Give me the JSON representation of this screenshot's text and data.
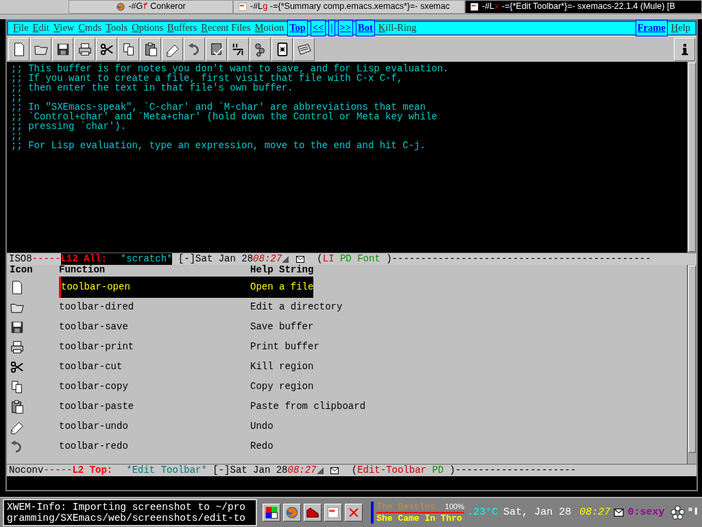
{
  "window_tabs": [
    {
      "kind": "browser",
      "tag": "-#G",
      "mark": "f",
      "title": "Conkeror",
      "selected": false
    },
    {
      "kind": "emacs",
      "tag": "-#L",
      "mark": "g",
      "title": "-={*Summary comp.emacs.xemacs*}=- sxemac",
      "selected": false
    },
    {
      "kind": "emacs",
      "tag": "-#L",
      "mark": "x",
      "title": "-={*Edit Toolbar*}=- sxemacs-22.1.4 (Mule) [B",
      "selected": true
    }
  ],
  "menubar": {
    "items": [
      {
        "label": "File",
        "kind": "plain"
      },
      {
        "label": "Edit",
        "kind": "plain"
      },
      {
        "label": "View",
        "kind": "plain"
      },
      {
        "label": "Cmds",
        "kind": "plain"
      },
      {
        "label": "Tools",
        "kind": "plain"
      },
      {
        "label": "Options",
        "kind": "plain"
      },
      {
        "label": "Buffers",
        "kind": "plain"
      },
      {
        "label": "Recent Files",
        "kind": "plain"
      },
      {
        "label": "Motion",
        "kind": "plain"
      },
      {
        "label": "Top",
        "kind": "boxed"
      },
      {
        "label": "<<",
        "kind": "boxed"
      },
      {
        "label": "|",
        "kind": "boxed"
      },
      {
        "label": ">>",
        "kind": "boxed"
      },
      {
        "label": "Bot",
        "kind": "boxed"
      },
      {
        "label": "Kill-Ring",
        "kind": "plain"
      }
    ],
    "right_items": [
      {
        "label": "Frame",
        "kind": "boxed"
      },
      {
        "label": "Help",
        "kind": "plain"
      }
    ]
  },
  "toolbar": [
    {
      "kind": "new"
    },
    {
      "kind": "open"
    },
    {
      "kind": "save"
    },
    {
      "kind": "print"
    },
    {
      "kind": "cut"
    },
    {
      "kind": "copy"
    },
    {
      "kind": "paste"
    },
    {
      "kind": "undo"
    },
    {
      "kind": "redo"
    },
    {
      "kind": "replace"
    },
    {
      "kind": "spell"
    },
    {
      "kind": "compile"
    },
    {
      "kind": "debug"
    },
    {
      "kind": "news"
    }
  ],
  "editor_lines": [
    ";; This buffer is for notes you don't want to save, and for Lisp evaluation.",
    ";; If you want to create a file, first visit that file with C-x C-f,",
    ";; then enter the text in that file's own buffer.",
    ";;",
    ";; In \"SXEmacs-speak\", `C-char' and `M-char' are abbreviations that mean",
    ";; `Control+char' and `Meta+char' (hold down the Control or Meta key while",
    ";; pressing `char').",
    ";;",
    ";; For Lisp evaluation, type an expression, move to the end and hit C-j."
  ],
  "modelines": [
    {
      "active": true,
      "segments": [
        {
          "kind": "plain",
          "text": "ISO8"
        },
        {
          "kind": "dashes",
          "text": "-----"
        },
        {
          "kind": "position",
          "text": "L12 All:"
        },
        {
          "kind": "buffer",
          "text": "*scratch*"
        },
        {
          "kind": "plain",
          "text": "[-]Sat Jan 28"
        },
        {
          "kind": "clock",
          "text": "08:27"
        },
        {
          "kind": "mail"
        },
        {
          "kind": "plain",
          "text": "("
        },
        {
          "kind": "major",
          "text": "LI"
        },
        {
          "kind": "minor",
          "text": "PD"
        },
        {
          "kind": "minor",
          "text": "Font"
        },
        {
          "kind": "plain",
          "text": ")---------------------------------------------"
        }
      ]
    },
    {
      "active": false,
      "segments": [
        {
          "kind": "plain",
          "text": "Noconv"
        },
        {
          "kind": "dashes",
          "text": "-----"
        },
        {
          "kind": "position",
          "text": "L2 Top:"
        },
        {
          "kind": "buffer",
          "text": "*Edit Toolbar*"
        },
        {
          "kind": "plain",
          "text": "[-]Sat Jan 28"
        },
        {
          "kind": "clock",
          "text": "08:27"
        },
        {
          "kind": "mail"
        },
        {
          "kind": "plain",
          "text": "("
        },
        {
          "kind": "major",
          "text": "Edit-Toolbar"
        },
        {
          "kind": "minor",
          "text": "PD"
        },
        {
          "kind": "plain",
          "text": ")---------------------"
        }
      ]
    }
  ],
  "toolbar_table": {
    "columns": [
      "Icon",
      "Function",
      "Help String"
    ],
    "rows": [
      {
        "function": "toolbar-open",
        "help": "Open a file",
        "selected": true
      },
      {
        "function": "toolbar-dired",
        "help": "Edit a directory",
        "selected": false
      },
      {
        "function": "toolbar-save",
        "help": "Save buffer",
        "selected": false
      },
      {
        "function": "toolbar-print",
        "help": "Print buffer",
        "selected": false
      },
      {
        "function": "toolbar-cut",
        "help": "Kill region",
        "selected": false
      },
      {
        "function": "toolbar-copy",
        "help": "Copy region",
        "selected": false
      },
      {
        "function": "toolbar-paste",
        "help": "Paste from clipboard",
        "selected": false
      },
      {
        "function": "toolbar-undo",
        "help": "Undo",
        "selected": false
      },
      {
        "function": "toolbar-redo",
        "help": "Redo",
        "selected": false
      }
    ]
  },
  "echo_area": [
    "XWEM-Info: Importing screenshot to ~/pro",
    "gramming/SXEmacs/web/screenshots/edit-to"
  ],
  "taskbar": {
    "apps": [
      {
        "kind": "grid"
      },
      {
        "kind": "browser"
      },
      {
        "kind": "shoe"
      },
      {
        "kind": "emacs"
      },
      {
        "kind": "close"
      }
    ],
    "music": {
      "artist": "The Beatles",
      "volume": "100%",
      "song": "She Came In Thro"
    },
    "temperature": ".23°C",
    "date": "Sat, Jan 28",
    "time": "08:27",
    "desktop": "0:sexy"
  }
}
